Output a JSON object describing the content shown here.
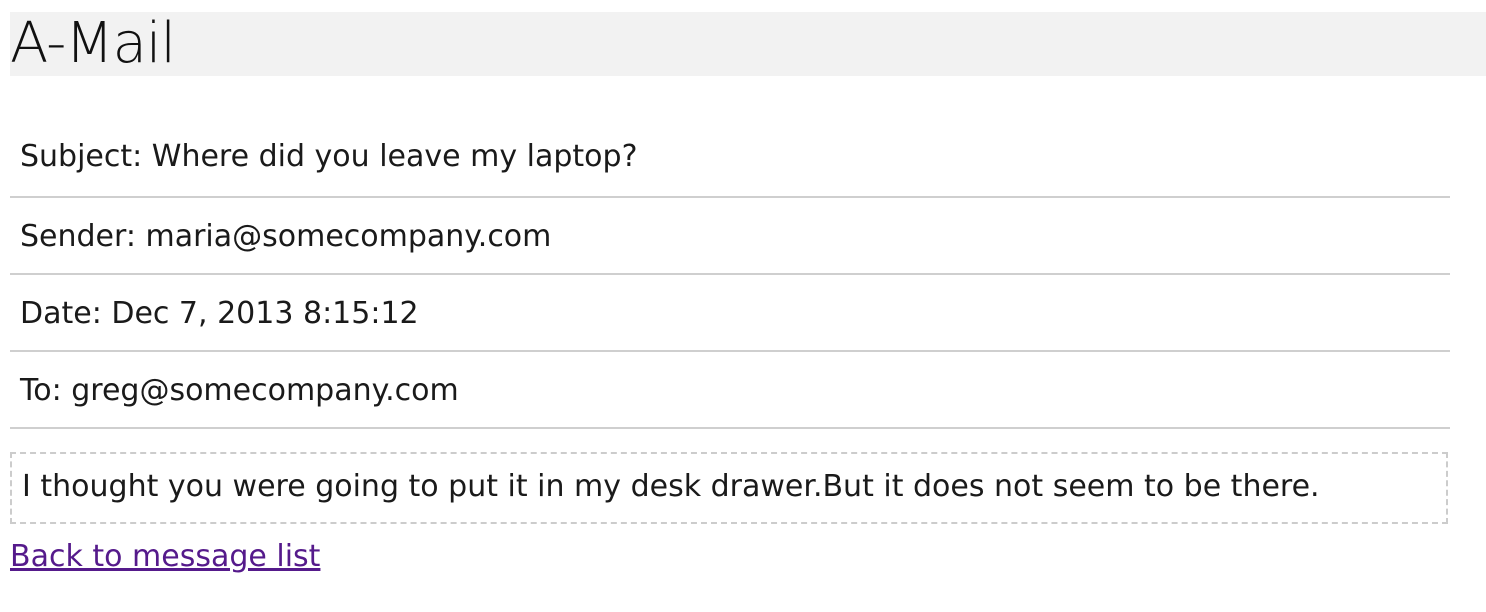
{
  "app": {
    "title": "A-Mail"
  },
  "message": {
    "subject_line": "Subject: Where did you leave my laptop?",
    "sender_line": "Sender: maria@somecompany.com",
    "date_line": "Date: Dec 7, 2013 8:15:12",
    "to_line": "To: greg@somecompany.com",
    "body": "I thought you were going to put it in my desk drawer.But it does not seem to be there."
  },
  "nav": {
    "back_label": "Back to message list"
  },
  "colors": {
    "header_bg": "#f2f2f2",
    "divider": "#cfcfcf",
    "link_visited": "#551a8b"
  }
}
